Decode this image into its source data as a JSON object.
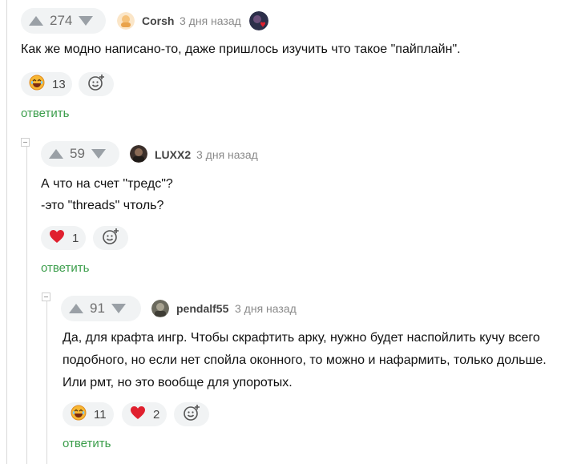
{
  "comments": [
    {
      "score": "274",
      "author": "Corsh",
      "time": "3 дня назад",
      "text": "Как же модно написано-то, даже пришлось изучить что такое \"пайплайн\".",
      "reactions": [
        {
          "icon": "laughing-face-icon",
          "count": "13"
        }
      ],
      "reply_label": "ответить"
    },
    {
      "score": "59",
      "author": "LUXX2",
      "time": "3 дня назад",
      "text_lines": [
        "А что на счет \"тредс\"?",
        "-это \"threads\" чтоль?"
      ],
      "reactions": [
        {
          "icon": "heart-icon",
          "count": "1"
        }
      ],
      "reply_label": "ответить"
    },
    {
      "score": "91",
      "author": "pendalf55",
      "time": "3 дня назад",
      "text_lines": [
        "Да, для крафта ингр. Чтобы скрафтить арку, нужно будет наспойлить кучу всего",
        "подобного, но если нет спойла оконного, то можно и нафармить, только дольше.",
        "Или рмт, но это вообще для упоротых."
      ],
      "reactions": [
        {
          "icon": "laughing-face-icon",
          "count": "11"
        },
        {
          "icon": "heart-icon",
          "count": "2"
        }
      ],
      "reply_label": "ответить"
    }
  ],
  "colors": {
    "reply": "#3a9d4a",
    "heart": "#e0202e",
    "pill_bg": "#f1f3f4"
  }
}
